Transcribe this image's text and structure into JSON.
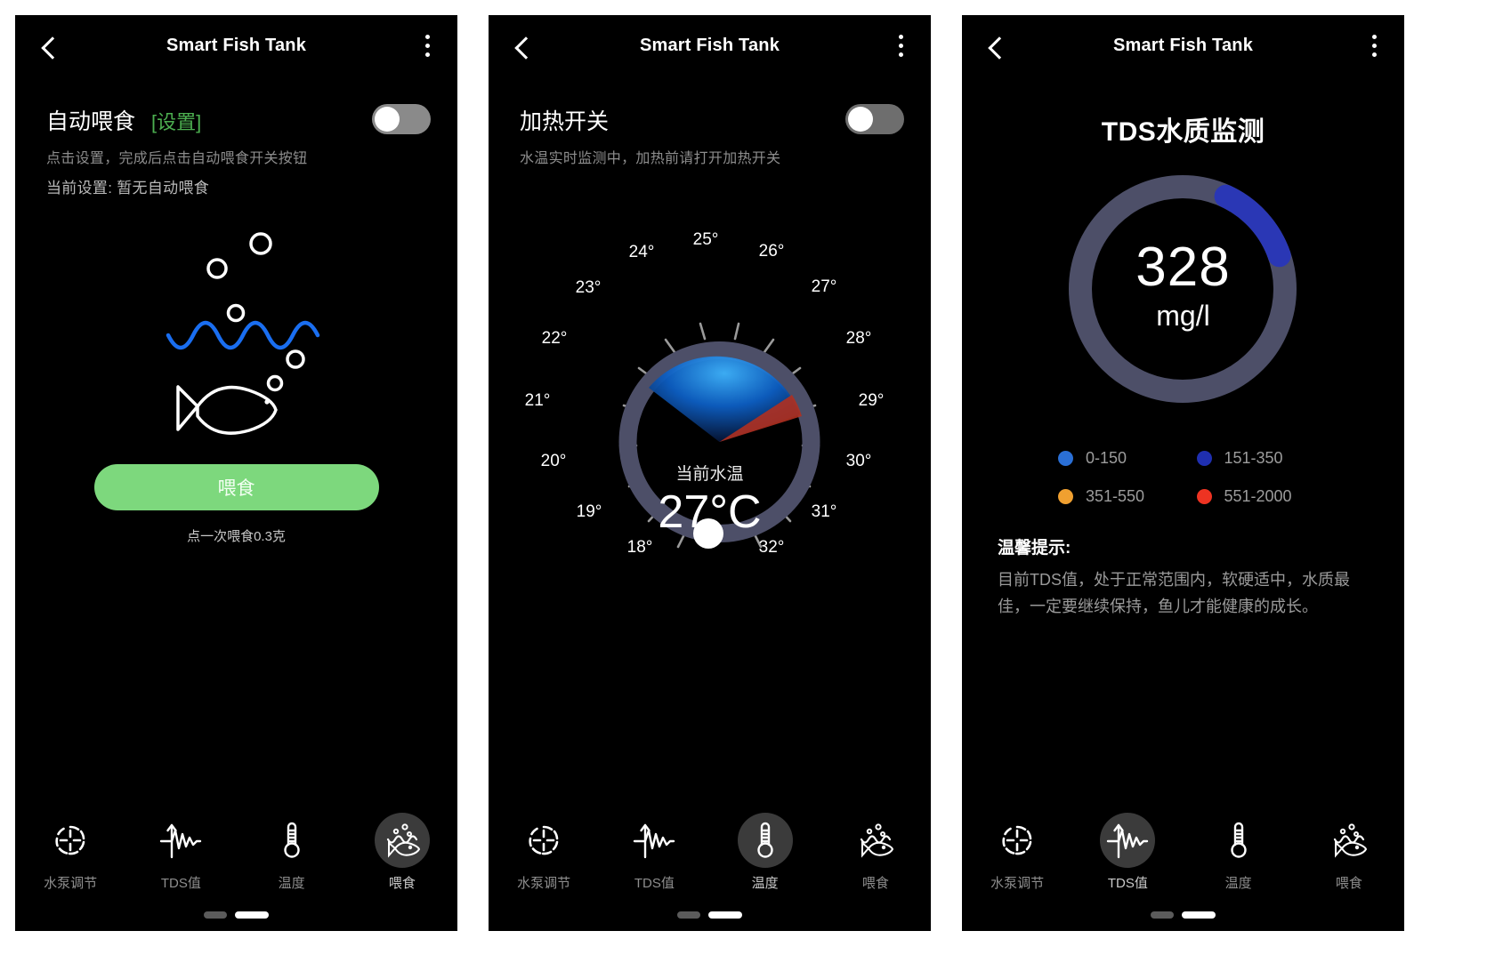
{
  "app": {
    "title": "Smart Fish Tank"
  },
  "icons": {
    "back": "back-chevron-icon",
    "menu": "kebab-menu-icon"
  },
  "screen1": {
    "setting_title": "自动喂食",
    "setting_link": "[设置]",
    "sub1": "点击设置，完成后点击自动喂食开关按钮",
    "sub2": "当前设置: 暂无自动喂食",
    "switch_state": "off",
    "feed_button": "喂食",
    "feed_note": "点一次喂食0.3克",
    "active_tab": "喂食"
  },
  "screen2": {
    "setting_title": "加热开关",
    "sub1": "水温实时监测中，加热前请打开加热开关",
    "switch_state": "off",
    "dial_label": "当前水温",
    "dial_value": "27°C",
    "active_tab": "温度",
    "ticks": [
      "18°",
      "19°",
      "20°",
      "21°",
      "22°",
      "23°",
      "24°",
      "25°",
      "26°",
      "27°",
      "28°",
      "29°",
      "30°",
      "31°",
      "32°"
    ],
    "current_tick": "27°"
  },
  "screen3": {
    "page_title": "TDS水质监测",
    "tds_value": "328",
    "tds_unit": "mg/l",
    "legend": [
      {
        "label": "0-150",
        "color": "#2a6fd6"
      },
      {
        "label": "151-350",
        "color": "#1f2fb0"
      },
      {
        "label": "351-550",
        "color": "#f0a030"
      },
      {
        "label": "551-2000",
        "color": "#ee3322"
      }
    ],
    "tips_title": "温馨提示:",
    "tips_body": "目前TDS值，处于正常范围内，软硬适中，水质最佳，一定要继续保持，鱼儿才能健康的成长。",
    "active_tab": "TDS值"
  },
  "nav": {
    "items": [
      {
        "label": "水泵调节",
        "icon": "pump-dial-icon"
      },
      {
        "label": "TDS值",
        "icon": "waveform-icon"
      },
      {
        "label": "温度",
        "icon": "thermometer-icon"
      },
      {
        "label": "喂食",
        "icon": "fish-feed-icon"
      }
    ]
  },
  "colors": {
    "accent_green": "#7dd87d",
    "ring_track": "#4d4f68",
    "ring_active": "#2a37b5",
    "link_green": "#4caf50"
  },
  "chart_data": [
    {
      "type": "gauge",
      "title": "当前水温",
      "value": 27,
      "unit": "°C",
      "min": 18,
      "max": 32,
      "tick_labels": [
        "18°",
        "19°",
        "20°",
        "21°",
        "22°",
        "23°",
        "24°",
        "25°",
        "26°",
        "27°",
        "28°",
        "29°",
        "30°",
        "31°",
        "32°"
      ],
      "handle_position_deg": 270,
      "legend_position": "none"
    },
    {
      "type": "gauge",
      "title": "TDS水质监测",
      "value": 328,
      "unit": "mg/l",
      "min": 0,
      "max": 2000,
      "bands": [
        {
          "name": "0-150",
          "from": 0,
          "to": 150,
          "color": "#2a6fd6"
        },
        {
          "name": "151-350",
          "from": 151,
          "to": 350,
          "color": "#1f2fb0"
        },
        {
          "name": "351-550",
          "from": 351,
          "to": 550,
          "color": "#f0a030"
        },
        {
          "name": "551-2000",
          "from": 551,
          "to": 2000,
          "color": "#ee3322"
        }
      ],
      "active_band": "151-350",
      "legend_position": "below"
    }
  ]
}
